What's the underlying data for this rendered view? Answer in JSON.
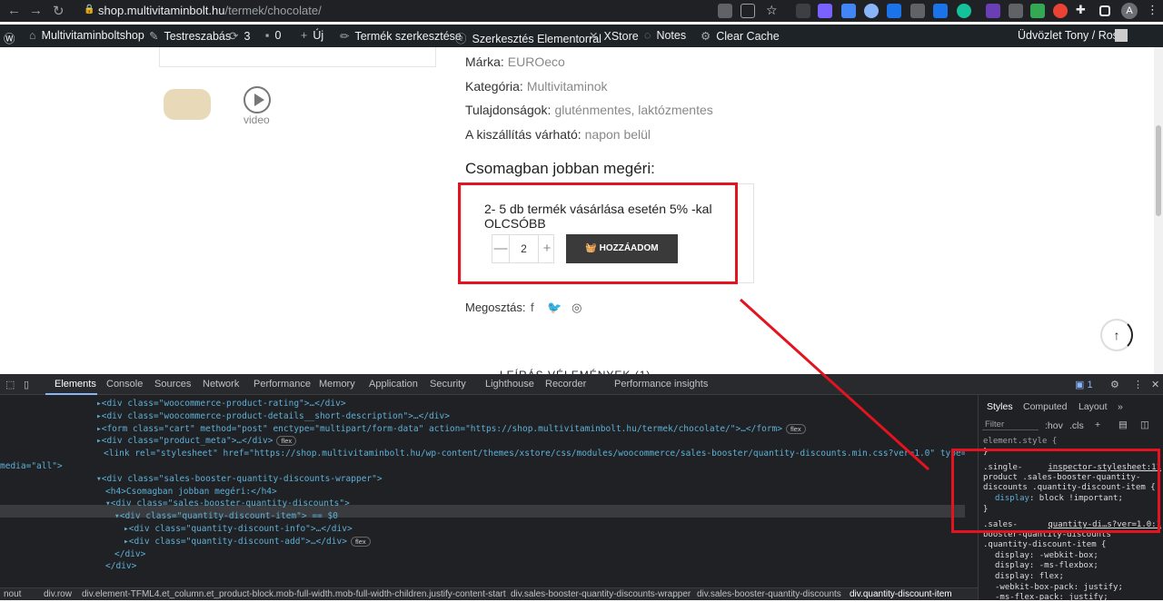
{
  "browser": {
    "url_host": "shop.multivitaminbolt.hu",
    "url_path": "/termek/chocolate/",
    "avatar_letter": "A"
  },
  "admin_bar": {
    "site": "Multivitaminboltshop",
    "customize": "Testreszabás",
    "updates": "3",
    "comments": "0",
    "new": "Új",
    "edit_product": "Termék szerkesztése",
    "elementor": "Szerkesztés Elementorral",
    "xstore": "XStore",
    "notes": "Notes",
    "clear_cache": "Clear Cache",
    "greeting": "Üdvözlet Tony / Rose!"
  },
  "product": {
    "brand_label": "Márka:",
    "brand_value": "EUROeco",
    "category_label": "Kategória:",
    "category_value": "Multivitaminok",
    "props_label": "Tulajdonságok:",
    "props_value": "gluténmentes, laktózmentes",
    "delivery_label": "A kiszállítás várható:",
    "delivery_value": "napon belül",
    "pack_heading": "Csomagban jobban megéri:",
    "discount_text": "2- 5 db termék vásárlása esetén 5% -kal OLCSÓBB",
    "qty_minus": "—",
    "qty_value": "2",
    "qty_plus": "+",
    "add_button": "HOZZÁADOM",
    "share_label": "Megosztás:",
    "video_label": "video",
    "tabs_peek": "LEÍRÁS     VÉLEMÉNYEK (1)"
  },
  "devtools": {
    "tabs": [
      "Elements",
      "Console",
      "Sources",
      "Network",
      "Performance",
      "Memory",
      "Application",
      "Security",
      "Lighthouse",
      "Recorder",
      "Performance insights"
    ],
    "issues_count": "1",
    "styles_tabs": [
      "Styles",
      "Computed",
      "Layout"
    ],
    "filter_placeholder": "Filter",
    "hov": ":hov",
    "cls": ".cls",
    "breadcrumbs": [
      "nout",
      "div.row",
      "div.element-TFML4.et_column.et_product-block.mob-full-width.mob-full-width-children.justify-content-start",
      "div.sales-booster-quantity-discounts-wrapper",
      "div.sales-booster-quantity-discounts",
      "div.quantity-discount-item"
    ],
    "dom_lines": [
      {
        "indent": 0,
        "html": "▸<div class=\"woocommerce-product-rating\">…</div>"
      },
      {
        "indent": 0,
        "html": "▸<div class=\"woocommerce-product-details__short-description\">…</div>"
      },
      {
        "indent": 0,
        "html": "▸<form class=\"cart\" method=\"post\" enctype=\"multipart/form-data\" action=\"https://shop.multivitaminbolt.hu/termek/chocolate/\">…</form>"
      },
      {
        "indent": 0,
        "html": "▸<div class=\"product_meta\">…</div>"
      },
      {
        "indent": 0,
        "html": "<link rel=\"stylesheet\" href=\"https://shop.multivitaminbolt.hu/wp-content/themes/xstore/css/modules/woocommerce/sales-booster/quantity-discounts.min.css?ver=1.0\" type=\"text/css\""
      },
      {
        "indent": 0,
        "html": "media=\"all\">"
      },
      {
        "indent": 0,
        "html": "▾<div class=\"sales-booster-quantity-discounts-wrapper\">"
      },
      {
        "indent": 1,
        "html": "<h4>Csomagban jobban megéri:</h4>"
      },
      {
        "indent": 1,
        "html": "▾<div class=\"sales-booster-quantity-discounts\">"
      },
      {
        "indent": 2,
        "html": "▾<div class=\"quantity-discount-item\"> == $0"
      },
      {
        "indent": 3,
        "html": "▸<div class=\"quantity-discount-info\">…</div>"
      },
      {
        "indent": 3,
        "html": "▸<div class=\"quantity-discount-add\">…</div>"
      },
      {
        "indent": 2,
        "html": "</div>"
      },
      {
        "indent": 1,
        "html": "</div>"
      }
    ],
    "style_lines": {
      "element_style": "element.style {",
      "close1": "}",
      "rule1_sel_a": ".single-",
      "rule1_src": "inspector-stylesheet:11",
      "rule1_sel_b": "product .sales-booster-quantity-",
      "rule1_sel_c": "discounts .quantity-discount-item {",
      "rule1_prop": "display",
      "rule1_val": "block !important;",
      "close2": "}",
      "rule2_sel_a": ".sales-",
      "rule2_src": "quantity-di…s?ver=1.0:1",
      "rule2_sel_b": "booster-quantity-discounts",
      "rule2_sel_c": ".quantity-discount-item {",
      "p1": "display: -webkit-box;",
      "p2": "display: -ms-flexbox;",
      "p3": "display: flex;",
      "p4": "-webkit-box-pack: justify;",
      "p5": "-ms-flex-pack: justify;"
    },
    "badges": {
      "flex": "flex"
    }
  },
  "colors": {
    "highlight_red": "#e3131f",
    "devtools_bg": "#202124",
    "button_dark": "#3a3a3a"
  }
}
